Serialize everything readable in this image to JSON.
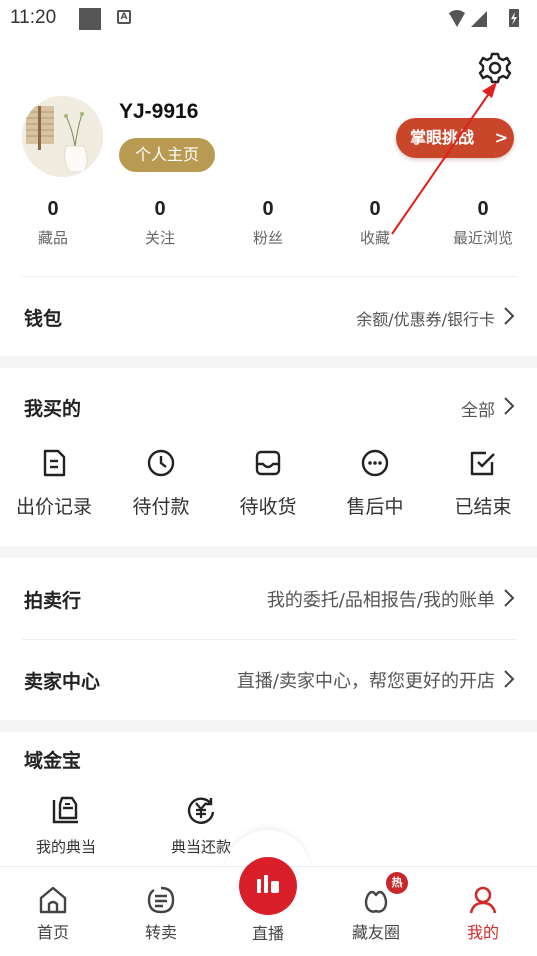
{
  "status_bar": {
    "time": "11:20"
  },
  "profile": {
    "username": "YJ-9916",
    "homepage_label": "个人主页",
    "challenge_label": "掌眼挑战",
    "challenge_chevron": ">"
  },
  "stats": [
    {
      "value": "0",
      "label": "藏品"
    },
    {
      "value": "0",
      "label": "关注"
    },
    {
      "value": "0",
      "label": "粉丝"
    },
    {
      "value": "0",
      "label": "收藏"
    },
    {
      "value": "0",
      "label": "最近浏览"
    }
  ],
  "wallet": {
    "title": "钱包",
    "subtitle": "余额/优惠券/银行卡"
  },
  "purchases": {
    "title": "我买的",
    "all_label": "全部",
    "items": [
      {
        "label": "出价记录",
        "icon": "document-icon"
      },
      {
        "label": "待付款",
        "icon": "clock-icon"
      },
      {
        "label": "待收货",
        "icon": "inbox-icon"
      },
      {
        "label": "售后中",
        "icon": "chat-dots-icon"
      },
      {
        "label": "已结束",
        "icon": "check-square-icon"
      }
    ]
  },
  "auction": {
    "title": "拍卖行",
    "subtitle": "我的委托/品相报告/我的账单"
  },
  "seller": {
    "title": "卖家中心",
    "subtitle": "直播/卖家中心，帮您更好的开店"
  },
  "yujinbao": {
    "title": "域金宝",
    "items": [
      {
        "label": "我的典当",
        "icon": "pawn-icon"
      },
      {
        "label": "典当还款",
        "icon": "yuan-repay-icon"
      }
    ]
  },
  "tabbar": {
    "items": [
      {
        "label": "首页",
        "icon": "home-icon"
      },
      {
        "label": "转卖",
        "icon": "resell-icon"
      },
      {
        "label": "直播",
        "icon": "live-icon"
      },
      {
        "label": "藏友圈",
        "icon": "collector-circle-icon",
        "badge": "热"
      },
      {
        "label": "我的",
        "icon": "user-icon",
        "active": true
      }
    ]
  },
  "colors": {
    "accent_red": "#d9202a",
    "gold": "#b99a52",
    "challenge_orange": "#c9462a"
  }
}
